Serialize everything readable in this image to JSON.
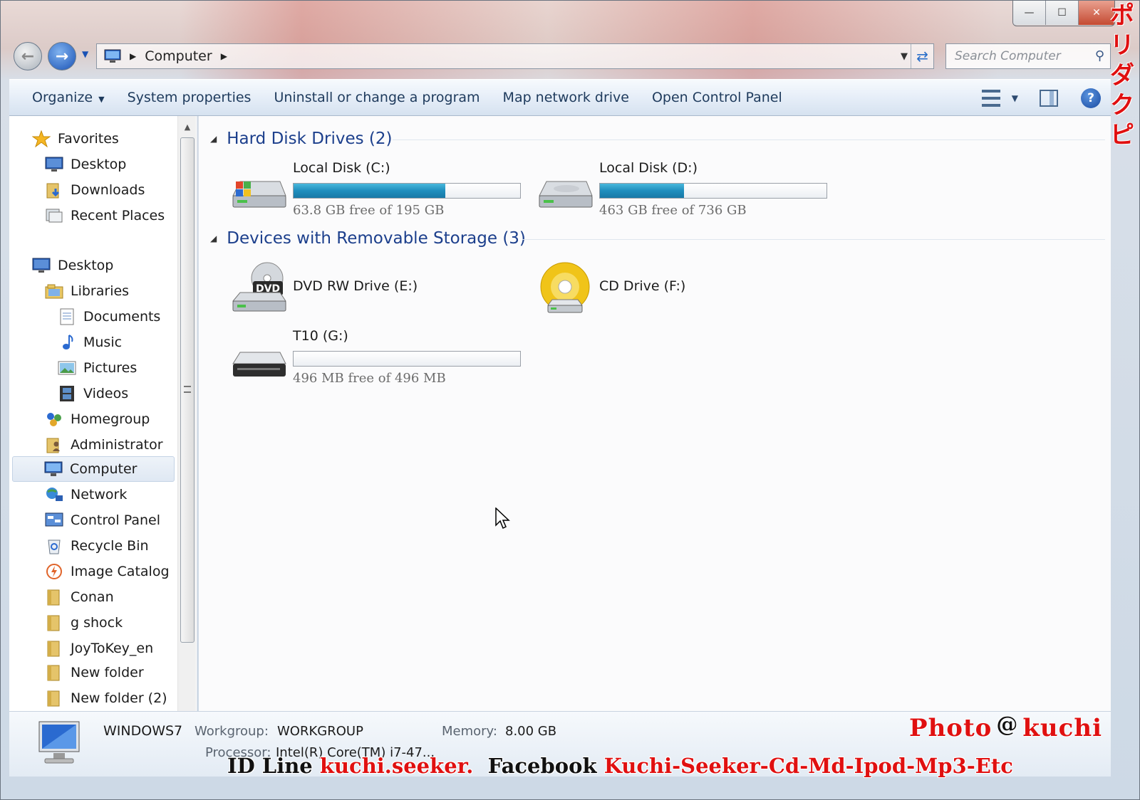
{
  "window": {
    "minimize_label": "—",
    "maximize_label": "☐",
    "close_label": "✕",
    "side_text": "ポリダクピ"
  },
  "address_bar": {
    "crumb": "Computer",
    "search_placeholder": "Search Computer"
  },
  "command_bar": {
    "items": [
      "Organize",
      "System properties",
      "Uninstall or change a program",
      "Map network drive",
      "Open Control Panel"
    ]
  },
  "nav_pane": {
    "items": [
      {
        "label": "Favorites",
        "icon": "star-icon"
      },
      {
        "label": "Desktop",
        "icon": "desktop-icon"
      },
      {
        "label": "Downloads",
        "icon": "downloads-folder-icon"
      },
      {
        "label": "Recent Places",
        "icon": "recent-places-icon"
      },
      {
        "label": "Desktop",
        "icon": "desktop-icon"
      },
      {
        "label": "Libraries",
        "icon": "libraries-icon"
      },
      {
        "label": "Documents",
        "icon": "document-icon"
      },
      {
        "label": "Music",
        "icon": "music-note-icon"
      },
      {
        "label": "Pictures",
        "icon": "picture-icon"
      },
      {
        "label": "Videos",
        "icon": "film-icon"
      },
      {
        "label": "Homegroup",
        "icon": "homegroup-icon"
      },
      {
        "label": "Administrator",
        "icon": "user-folder-icon"
      },
      {
        "label": "Computer",
        "icon": "computer-icon"
      },
      {
        "label": "Network",
        "icon": "network-icon"
      },
      {
        "label": "Control Panel",
        "icon": "control-panel-icon"
      },
      {
        "label": "Recycle Bin",
        "icon": "recycle-bin-icon"
      },
      {
        "label": "Image Catalog",
        "icon": "image-catalog-icon"
      },
      {
        "label": "Conan",
        "icon": "folder-icon"
      },
      {
        "label": "g shock",
        "icon": "folder-icon"
      },
      {
        "label": "JoyToKey_en",
        "icon": "folder-icon"
      },
      {
        "label": "New folder",
        "icon": "folder-icon"
      },
      {
        "label": "New folder (2)",
        "icon": "folder-icon"
      }
    ],
    "selected": "Computer"
  },
  "content": {
    "hard_disk_group": "Hard Disk Drives (2)",
    "removable_group": "Devices with Removable Storage (3)",
    "drives": [
      {
        "name": "Local Disk (C:)",
        "free_text": "63.8 GB free of 195 GB",
        "used_fraction": 0.67,
        "icon": "windows-hard-disk-icon"
      },
      {
        "name": "Local Disk (D:)",
        "free_text": "463 GB free of 736 GB",
        "used_fraction": 0.37,
        "icon": "hard-disk-icon"
      },
      {
        "name": "DVD RW Drive (E:)",
        "icon": "dvd-drive-icon",
        "badge": "DVD"
      },
      {
        "name": "CD Drive (F:)",
        "icon": "cd-drive-icon"
      },
      {
        "name": "T10 (G:)",
        "free_text": "496 MB free of 496 MB",
        "used_fraction": 0.0,
        "icon": "removable-drive-icon"
      }
    ]
  },
  "details": {
    "computer_name": "WINDOWS7",
    "workgroup_label": "Workgroup:",
    "workgroup_value": "WORKGROUP",
    "memory_label": "Memory:",
    "memory_value": "8.00 GB",
    "processor_label": "Processor:",
    "processor_value": "Intel(R) Core(TM) i7-47..."
  },
  "watermark": {
    "photo": "Photo",
    "at": "@",
    "kuchi": "kuchi",
    "id_line_label": "ID Line",
    "id_line_value": "kuchi.seeker.",
    "facebook_label": "Facebook",
    "facebook_value": "Kuchi-Seeker-Cd-Md-Ipod-Mp3-Etc"
  },
  "colors": {
    "accent_blue": "#1c3f8c",
    "bar_fill": "#1f8ebd",
    "watermark_red": "#e01010"
  }
}
